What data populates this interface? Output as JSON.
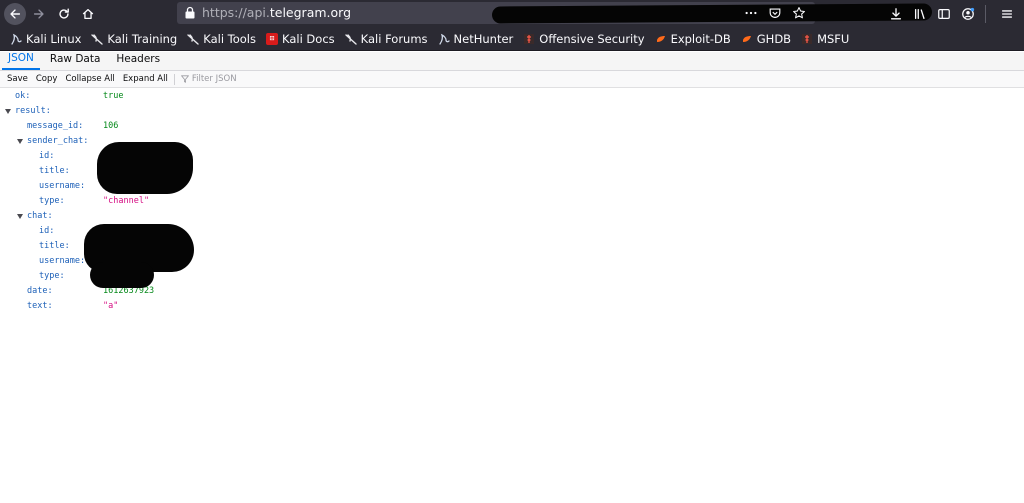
{
  "browser": {
    "url_prefix": "https://api.",
    "url_domain": "telegram.org",
    "bookmarks": [
      {
        "label": "Kali Linux",
        "icon": "kali-dragon-icon"
      },
      {
        "label": "Kali Training",
        "icon": "kali-dragon-icon"
      },
      {
        "label": "Kali Tools",
        "icon": "kali-dragon-icon"
      },
      {
        "label": "Kali Docs",
        "icon": "kali-docs-icon"
      },
      {
        "label": "Kali Forums",
        "icon": "kali-dragon-icon"
      },
      {
        "label": "NetHunter",
        "icon": "kali-dragon-icon"
      },
      {
        "label": "Offensive Security",
        "icon": "offsec-icon"
      },
      {
        "label": "Exploit-DB",
        "icon": "exploit-db-icon"
      },
      {
        "label": "GHDB",
        "icon": "exploit-db-icon"
      },
      {
        "label": "MSFU",
        "icon": "offsec-icon"
      }
    ]
  },
  "viewer": {
    "tabs": [
      "JSON",
      "Raw Data",
      "Headers"
    ],
    "toolbar": {
      "save": "Save",
      "copy": "Copy",
      "collapse_all": "Collapse All",
      "expand_all": "Expand All",
      "filter_placeholder": "Filter JSON"
    }
  },
  "json": {
    "ok_key": "ok:",
    "ok_val": "true",
    "result_key": "result:",
    "message_id_key": "message_id:",
    "message_id_val": "106",
    "sender_chat_key": "sender_chat:",
    "sender_id_key": "id:",
    "sender_title_key": "title:",
    "sender_username_key": "username:",
    "sender_type_key": "type:",
    "sender_type_val": "\"channel\"",
    "chat_key": "chat:",
    "chat_id_key": "id:",
    "chat_title_key": "title:",
    "chat_username_key": "username:",
    "chat_type_key": "type:",
    "date_key": "date:",
    "date_val": "1612637923",
    "text_key": "text:",
    "text_val": "\"a\""
  }
}
